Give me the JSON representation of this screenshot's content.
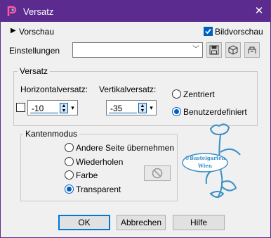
{
  "window": {
    "title": "Versatz"
  },
  "preview": {
    "label": "Vorschau",
    "image_preview_label": "Bildvorschau",
    "image_preview_checked": true
  },
  "settings": {
    "label": "Einstellungen",
    "value": ""
  },
  "offset": {
    "group_label": "Versatz",
    "horizontal_label": "Horizontalversatz:",
    "vertical_label": "Vertikalversatz:",
    "horizontal_value": "-10",
    "vertical_value": "-35",
    "centered_label": "Zentriert",
    "user_defined_label": "Benutzerdefiniert",
    "selected": "user_defined"
  },
  "edge_mode": {
    "group_label": "Kantenmodus",
    "options": [
      "Andere Seite übernehmen",
      "Wiederholen",
      "Farbe",
      "Transparent"
    ],
    "selected": "Transparent"
  },
  "watermark": {
    "line1": "©Bastelgarten",
    "line2": "Wien"
  },
  "buttons": {
    "ok": "OK",
    "cancel": "Abbrechen",
    "help": "Hilfe"
  },
  "colors": {
    "titlebar": "#5b2b8f",
    "accent": "#0060c0",
    "watermark": "#3a8fc8"
  }
}
